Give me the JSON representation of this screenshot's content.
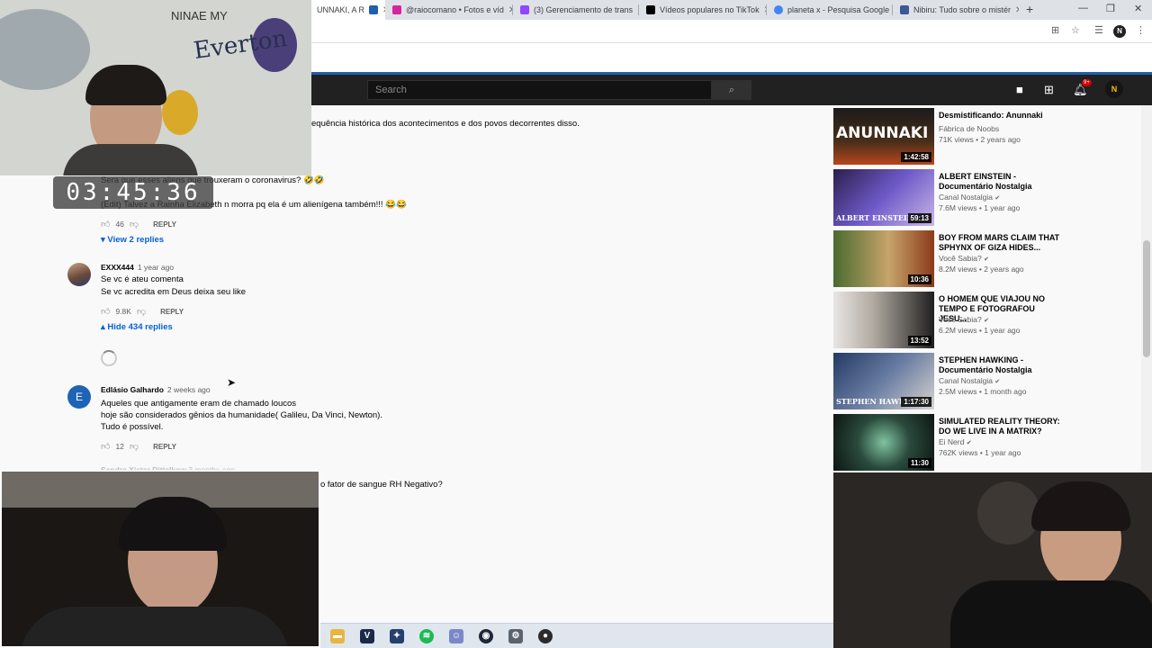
{
  "browser": {
    "tabs": [
      {
        "title": "UNNAKI, A R",
        "active": true,
        "favicon": "youtube-icon",
        "color": "#1f5fae"
      },
      {
        "title": "@raiocomano • Fotos e víd",
        "favicon": "instagram-icon",
        "color": "#d6249f"
      },
      {
        "title": "(3) Gerenciamento de trans",
        "favicon": "twitch-icon",
        "color": "#9146ff"
      },
      {
        "title": "Vídeos populares no TikTok",
        "favicon": "tiktok-icon",
        "color": "#000000"
      },
      {
        "title": "planeta x - Pesquisa Google",
        "favicon": "google-icon",
        "color": "#4285f4"
      },
      {
        "title": "Nibiru: Tudo sobre o mistér",
        "favicon": "news-icon",
        "color": "#3b5998"
      }
    ],
    "profile_initial": "N"
  },
  "masthead": {
    "search_placeholder": "Search",
    "notifications_badge": "9+",
    "avatar_initial": "N"
  },
  "timer": "03:45:36",
  "content": {
    "top_line": "equência histórica dos acontecimentos e dos povos decorrentes  disso.",
    "partial_comment": {
      "line1": "Sera que esses aliens que trouxeram o coronavirus? 🤣🤣",
      "line2": "(Edit) Talvez a Rainha Elizabeth n morra pq ela é um alienígena também!!! 😂😂",
      "likes": "46",
      "reply_label": "REPLY",
      "replies_toggle": "View 2 replies"
    },
    "comments": [
      {
        "author": "EXXX444",
        "time": "1 year ago",
        "lines": [
          "Se vc é ateu comenta",
          "Se vc acredita em Deus deixa seu like"
        ],
        "likes": "9.8K",
        "reply_label": "REPLY",
        "replies_toggle": "Hide 434 replies"
      },
      {
        "author": "Edlásio Galhardo",
        "time": "2 weeks ago",
        "avatar_letter": "E",
        "lines": [
          "Aqueles que antigamente eram de chamado loucos",
          "hoje são considerados gênios da humanidade( Galileu, Da Vinci, Newton).",
          "Tudo é possível."
        ],
        "likes": "12",
        "reply_label": "REPLY"
      }
    ],
    "cut_comment_author": "Sandra Xister Dittelkow",
    "cut_comment_time": "3 months ago",
    "bottom_line": "o fator de sangue RH Negativo?"
  },
  "recommendations": [
    {
      "title": "Desmistificando: Anunnaki",
      "channel": "Fábrica de Noobs",
      "verified": false,
      "views": "71K views",
      "age": "2 years ago",
      "duration": "1:42:58",
      "thumb_text": "ANUNNAKI"
    },
    {
      "title": "ALBERT EINSTEIN - Documentário Nostalgia",
      "channel": "Canal Nostalgia",
      "verified": true,
      "views": "7.6M views",
      "age": "1 year ago",
      "duration": "59:13",
      "thumb_text": "ALBERT EINSTEIN"
    },
    {
      "title": "BOY FROM MARS CLAIM THAT SPHYNX OF GIZA HIDES...",
      "channel": "Você Sabia?",
      "verified": true,
      "views": "8.2M views",
      "age": "2 years ago",
      "duration": "10:36",
      "thumb_text": ""
    },
    {
      "title": "O HOMEM QUE VIAJOU NO TEMPO E FOTOGRAFOU JESU...",
      "channel": "Você Sabia?",
      "verified": true,
      "views": "6.2M views",
      "age": "1 year ago",
      "duration": "13:52",
      "thumb_text": ""
    },
    {
      "title": "STEPHEN HAWKING - Documentário Nostalgia",
      "channel": "Canal Nostalgia",
      "verified": true,
      "views": "2.5M views",
      "age": "1 month ago",
      "duration": "1:17:30",
      "thumb_text": "STEPHEN HAWKIN"
    },
    {
      "title": "SIMULATED REALITY THEORY: DO WE LIVE IN A MATRIX?",
      "channel": "Ei Nerd",
      "verified": true,
      "views": "762K views",
      "age": "1 year ago",
      "duration": "11:30",
      "thumb_text": ""
    }
  ],
  "taskbar_icons": [
    "folder-icon",
    "v-app-icon",
    "bot-app-icon",
    "spotify-icon",
    "discord-icon",
    "steam-icon",
    "settings-icon",
    "obs-icon"
  ],
  "webcam_text": {
    "wall_text_1": "Everton",
    "wall_text_2": "NINAE MY"
  }
}
